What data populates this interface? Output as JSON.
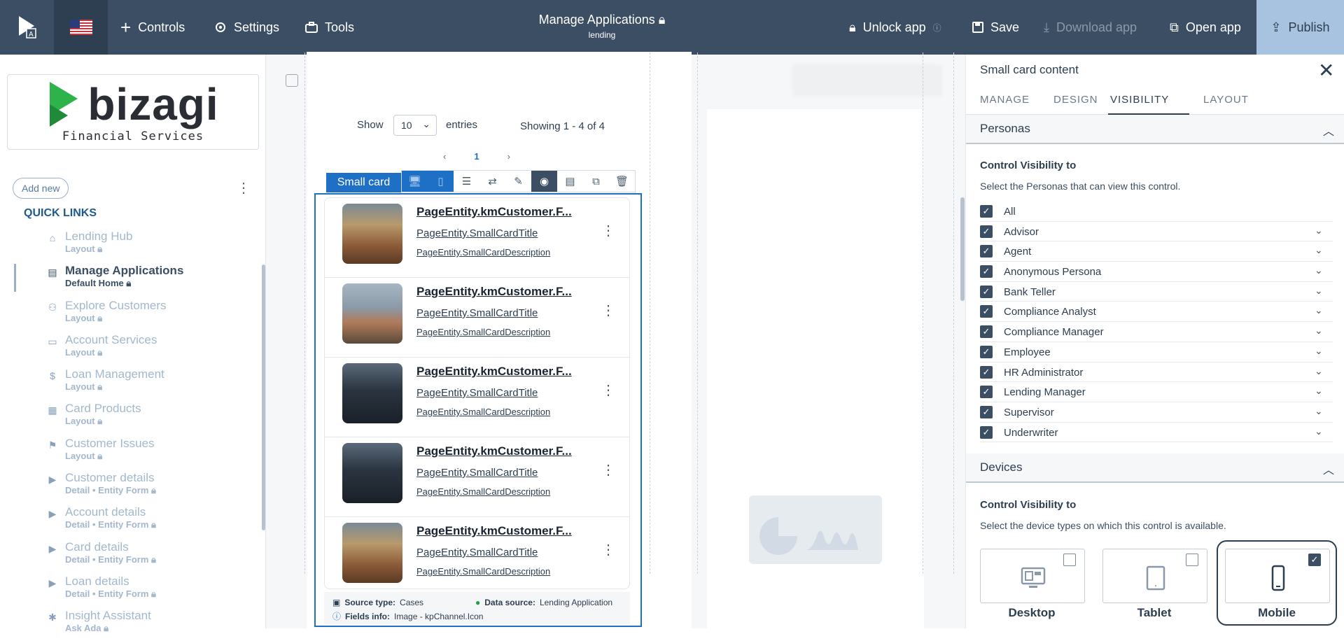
{
  "topbar": {
    "controls": "Controls",
    "settings": "Settings",
    "tools": "Tools",
    "title": "Manage Applications",
    "subtitle": "lending",
    "unlock": "Unlock app",
    "save": "Save",
    "download": "Download app",
    "open": "Open app",
    "publish": "Publish"
  },
  "sidebar": {
    "logo_word": "bizagi",
    "logo_sub": "Financial Services",
    "add_new": "Add new",
    "quick_links": "QUICK LINKS",
    "items": [
      {
        "label": "Lending Hub",
        "sub": "Layout",
        "icon": "home-icon"
      },
      {
        "label": "Manage Applications",
        "sub": "Default Home",
        "icon": "apps-icon"
      },
      {
        "label": "Explore Customers",
        "sub": "Layout",
        "icon": "users-icon"
      },
      {
        "label": "Account Services",
        "sub": "Layout",
        "icon": "archive-icon"
      },
      {
        "label": "Loan Management",
        "sub": "Layout",
        "icon": "dollar-icon"
      },
      {
        "label": "Card Products",
        "sub": "Layout",
        "icon": "cards-icon"
      },
      {
        "label": "Customer Issues",
        "sub": "Layout",
        "icon": "issue-icon"
      },
      {
        "label": "Customer details",
        "sub": "Detail • Entity Form",
        "icon": "form-icon"
      },
      {
        "label": "Account details",
        "sub": "Detail • Entity Form",
        "icon": "form-icon"
      },
      {
        "label": "Card details",
        "sub": "Detail • Entity Form",
        "icon": "form-icon"
      },
      {
        "label": "Loan details",
        "sub": "Detail • Entity Form",
        "icon": "form-icon"
      },
      {
        "label": "Insight Assistant",
        "sub": "Ask Ada",
        "icon": "sparkle-icon"
      }
    ]
  },
  "canvas": {
    "show": "Show",
    "show_value": "10",
    "entries": "entries",
    "showing": "Showing 1 - 4 of 4",
    "page": "1",
    "tag": "Small card",
    "cards": [
      {
        "t1": "PageEntity.kmCustomer.F...",
        "t2": "PageEntity.SmallCardTitle",
        "t3": "PageEntity.SmallCardDescription"
      },
      {
        "t1": "PageEntity.kmCustomer.F...",
        "t2": "PageEntity.SmallCardTitle",
        "t3": "PageEntity.SmallCardDescription"
      },
      {
        "t1": "PageEntity.kmCustomer.F...",
        "t2": "PageEntity.SmallCardTitle",
        "t3": "PageEntity.SmallCardDescription"
      },
      {
        "t1": "PageEntity.kmCustomer.F...",
        "t2": "PageEntity.SmallCardTitle",
        "t3": "PageEntity.SmallCardDescription"
      },
      {
        "t1": "PageEntity.kmCustomer.F...",
        "t2": "PageEntity.SmallCardTitle",
        "t3": "PageEntity.SmallCardDescription"
      }
    ],
    "source_type_label": "Source type:",
    "source_type": "Cases",
    "data_source_label": "Data source:",
    "data_source": "Lending Application",
    "fields_label": "Fields info:",
    "fields": "Image - kpChannel.Icon"
  },
  "panel": {
    "title": "Small card content",
    "tabs": [
      "MANAGE",
      "DESIGN",
      "VISIBILITY",
      "LAYOUT"
    ],
    "personas_title": "Personas",
    "cv_label": "Control Visibility to",
    "personas_help": "Select the Personas that can view this control.",
    "personas": [
      "All",
      "Advisor",
      "Agent",
      "Anonymous Persona",
      "Bank Teller",
      "Compliance Analyst",
      "Compliance Manager",
      "Employee",
      "HR Administrator",
      "Lending Manager",
      "Supervisor",
      "Underwriter"
    ],
    "devices_title": "Devices",
    "devices_help": "Select the device types on which this control is available.",
    "devices": [
      {
        "label": "Desktop",
        "checked": false
      },
      {
        "label": "Tablet",
        "checked": false
      },
      {
        "label": "Mobile",
        "checked": true
      }
    ]
  },
  "colors": {
    "topbar": "#3b4e63",
    "accent": "#1e6fc6",
    "publish": "#a8c3e0",
    "logo_green": "#2db34a"
  }
}
